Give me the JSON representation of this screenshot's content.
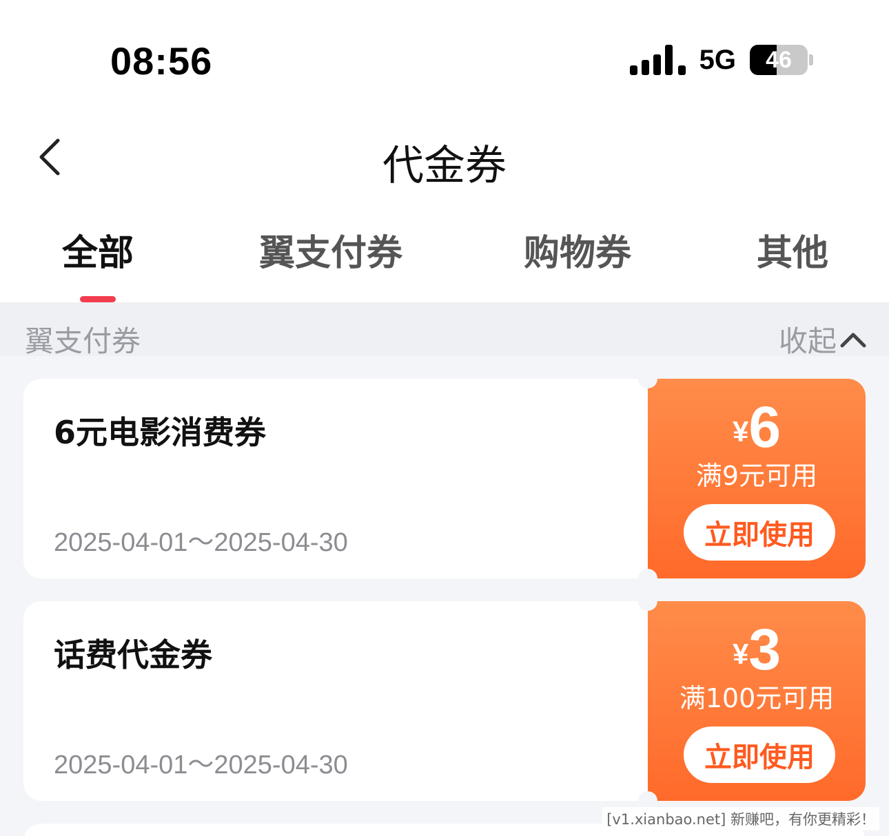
{
  "status_bar": {
    "time": "08:56",
    "network": "5G",
    "battery": "46",
    "battery_level_percent": 46
  },
  "nav": {
    "title": "代金券"
  },
  "tabs": [
    {
      "label": "全部",
      "active": true
    },
    {
      "label": "翼支付券",
      "active": false
    },
    {
      "label": "购物券",
      "active": false
    },
    {
      "label": "其他",
      "active": false
    }
  ],
  "section": {
    "title": "翼支付券",
    "collapse_label": "收起"
  },
  "coupons": [
    {
      "name": "6元电影消费券",
      "validity": "2025-04-01～2025-04-30",
      "currency": "¥",
      "amount": "6",
      "condition": "满9元可用",
      "action": "立即使用"
    },
    {
      "name": "话费代金券",
      "validity": "2025-04-01～2025-04-30",
      "currency": "¥",
      "amount": "3",
      "condition": "满100元可用",
      "action": "立即使用"
    }
  ],
  "watermark": "[v1.xianbao.net] 新赚吧，有你更精彩！",
  "colors": {
    "accent_red": "#f23d4f",
    "coupon_orange_top": "#ff8c4a",
    "coupon_orange_bottom": "#ff6a2a"
  }
}
